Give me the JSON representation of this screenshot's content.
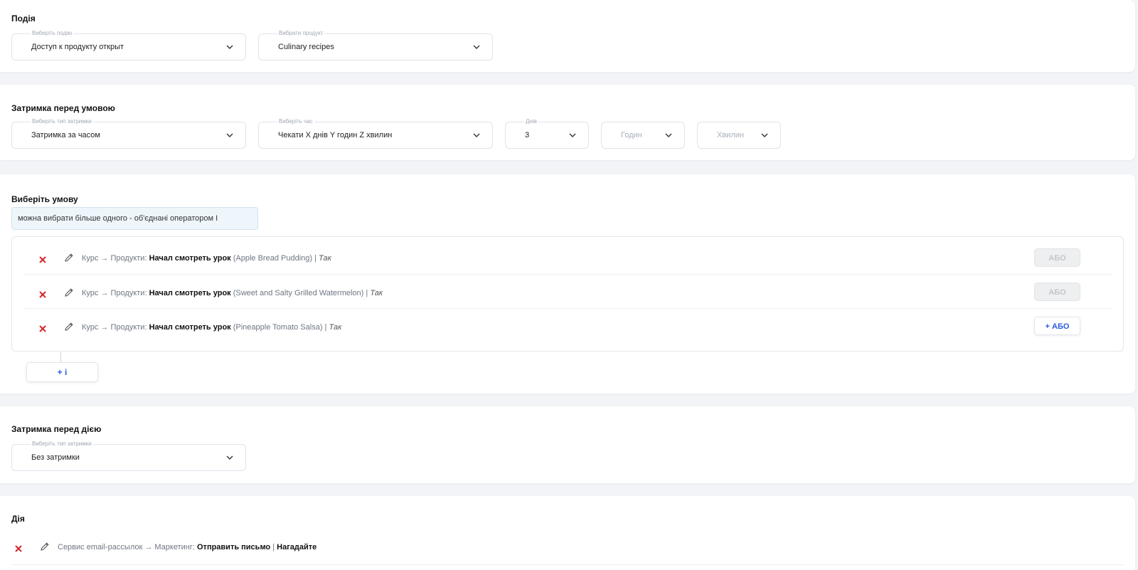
{
  "event_section": {
    "title": "Подія",
    "event_field": {
      "label": "Виберіть подію",
      "value": "Доступ к продукту открыт"
    },
    "product_field": {
      "label": "Вибрати продукт",
      "value": "Culinary recipes"
    }
  },
  "delay_before_condition": {
    "title": "Затримка перед умовою",
    "type_field": {
      "label": "Виберіть тип затримки",
      "value": "Затримка за часом"
    },
    "time_field": {
      "label": "Виберіть час",
      "value": "Чекати X днів Y годин Z хвилин"
    },
    "days_field": {
      "label": "Днів",
      "value": "3"
    },
    "hours_field": {
      "placeholder": "Годин"
    },
    "minutes_field": {
      "placeholder": "Хвилин"
    }
  },
  "condition_section": {
    "title": "Виберіть умову",
    "hint": "можна вибрати більше одного - об'єднані оператором І",
    "conditions": [
      {
        "prefix": "Курс → Продукти: ",
        "action": "Начал смотреть урок",
        "item": " (Apple Bread Pudding) | ",
        "result": "Так",
        "or_label": "АБО"
      },
      {
        "prefix": "Курс → Продукти: ",
        "action": "Начал смотреть урок",
        "item": " (Sweet and Salty Grilled Watermelon) | ",
        "result": "Так",
        "or_label": "АБО"
      },
      {
        "prefix": "Курс → Продукти: ",
        "action": "Начал смотреть урок",
        "item": " (Pineapple Tomato Salsa) | ",
        "result": "Так",
        "or_label": "+ АБО"
      }
    ],
    "and_button": "+ і"
  },
  "delay_before_action": {
    "title": "Затримка перед дією",
    "type_field": {
      "label": "Виберіть тип затримки",
      "value": "Без затримки"
    }
  },
  "action_section": {
    "title": "Дія",
    "action": {
      "prefix": "Сервис email-рассылок → Маркетинг: ",
      "name": "Отправить письмо",
      "separator": " | ",
      "detail": "Нагадайте"
    }
  },
  "colors": {
    "remove_icon": "#d6252b",
    "accent": "#2c5be0",
    "hint_bg": "#eef6fb"
  }
}
